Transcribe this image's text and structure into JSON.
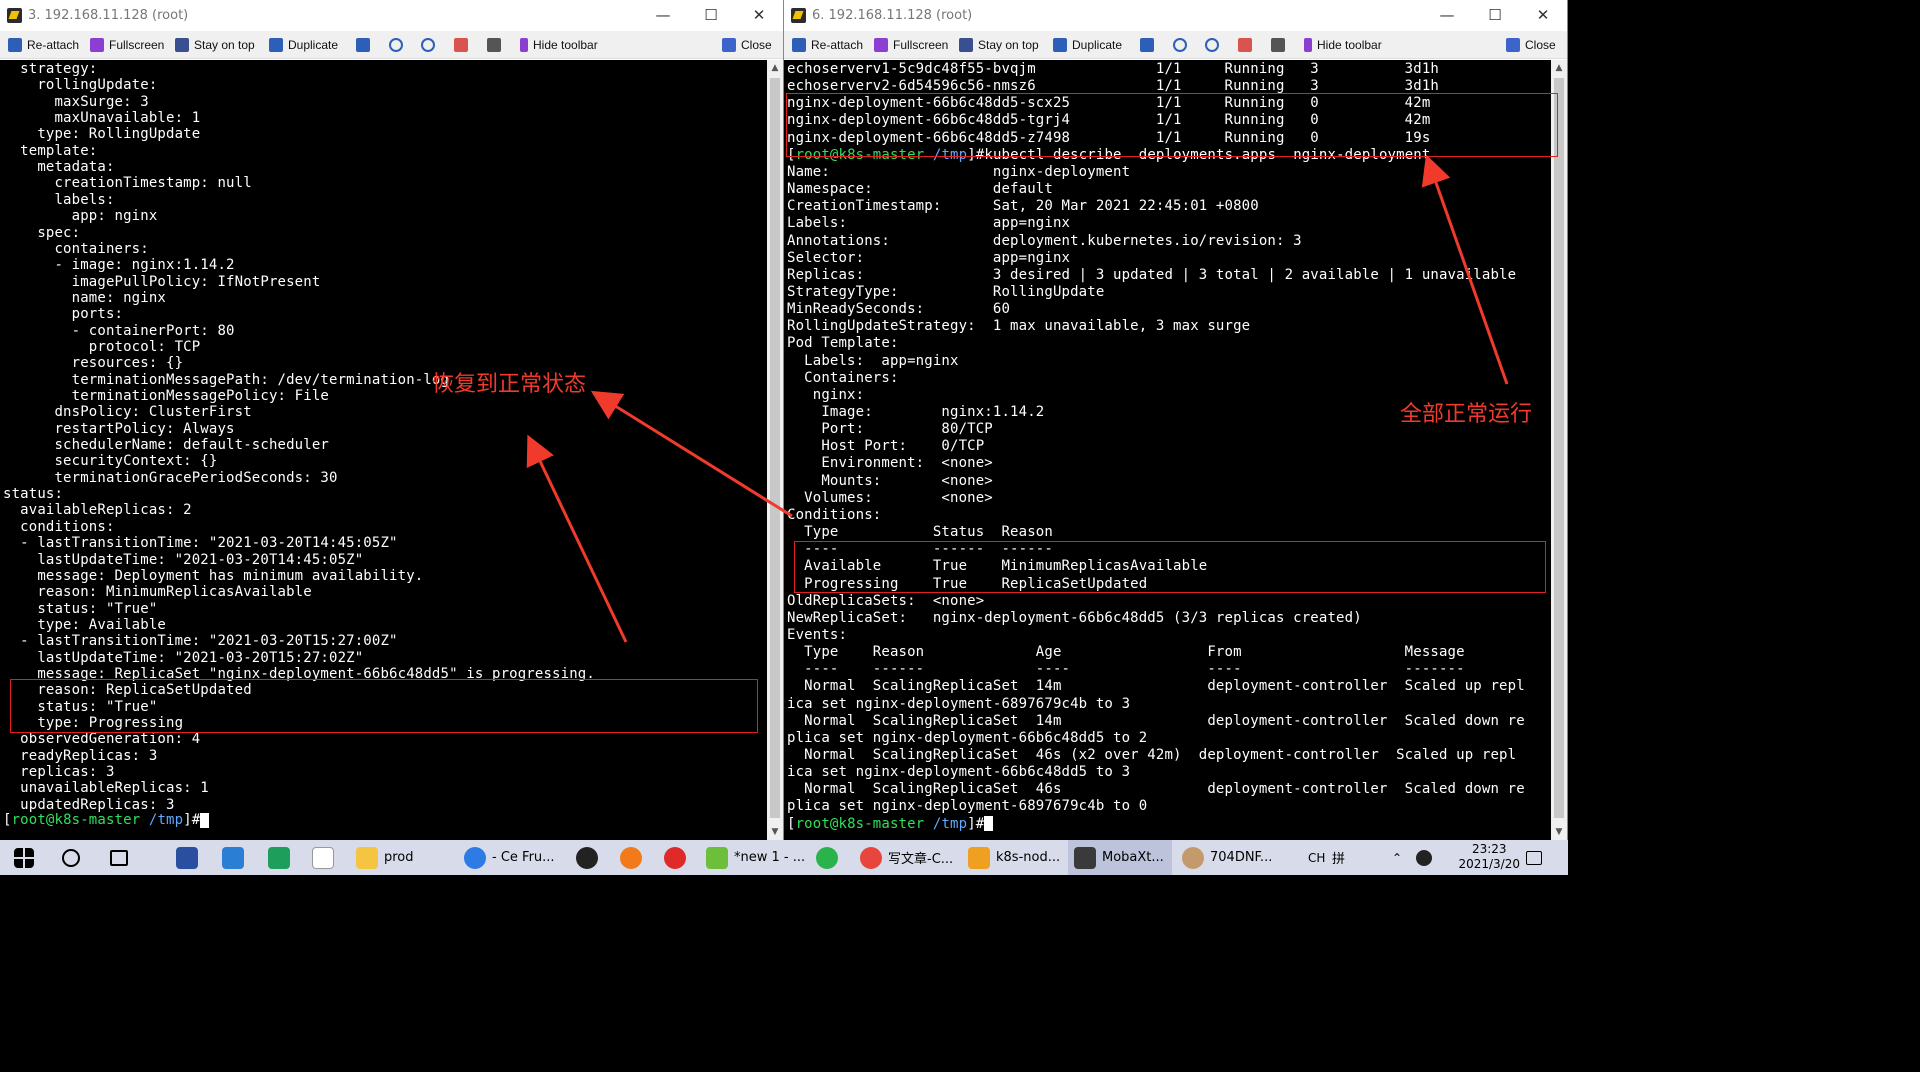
{
  "left_window": {
    "title": "3. 192.168.11.128 (root)",
    "toolbar": {
      "reattach": "Re-attach",
      "fullscreen": "Fullscreen",
      "stay_on_top": "Stay on top",
      "duplicate": "Duplicate",
      "hide_toolbar": "Hide toolbar",
      "close": "Close"
    },
    "lines": [
      "  strategy:",
      "    rollingUpdate:",
      "      maxSurge: 3",
      "      maxUnavailable: 1",
      "    type: RollingUpdate",
      "  template:",
      "    metadata:",
      "      creationTimestamp: null",
      "      labels:",
      "        app: nginx",
      "    spec:",
      "      containers:",
      "      - image: nginx:1.14.2",
      "        imagePullPolicy: IfNotPresent",
      "        name: nginx",
      "        ports:",
      "        - containerPort: 80",
      "          protocol: TCP",
      "        resources: {}",
      "        terminationMessagePath: /dev/termination-log",
      "        terminationMessagePolicy: File",
      "      dnsPolicy: ClusterFirst",
      "      restartPolicy: Always",
      "      schedulerName: default-scheduler",
      "      securityContext: {}",
      "      terminationGracePeriodSeconds: 30",
      "status:",
      "  availableReplicas: 2",
      "  conditions:",
      "  - lastTransitionTime: \"2021-03-20T14:45:05Z\"",
      "    lastUpdateTime: \"2021-03-20T14:45:05Z\"",
      "    message: Deployment has minimum availability.",
      "    reason: MinimumReplicasAvailable",
      "    status: \"True\"",
      "    type: Available",
      "  - lastTransitionTime: \"2021-03-20T15:27:00Z\"",
      "    lastUpdateTime: \"2021-03-20T15:27:02Z\"",
      "    message: ReplicaSet \"nginx-deployment-66b6c48dd5\" is progressing.",
      "    reason: ReplicaSetUpdated",
      "    status: \"True\"",
      "    type: Progressing",
      "  observedGeneration: 4",
      "  readyReplicas: 3",
      "  replicas: 3",
      "  unavailableReplicas: 1",
      "  updatedReplicas: 3"
    ],
    "prompt": {
      "open": "[",
      "user_host": "root@k8s-master",
      "path": " /tmp",
      "close": "]#"
    },
    "annotation": "恢复到正常状态"
  },
  "right_window": {
    "title": "6. 192.168.11.128 (root)",
    "toolbar": {
      "reattach": "Re-attach",
      "fullscreen": "Fullscreen",
      "stay_on_top": "Stay on top",
      "duplicate": "Duplicate",
      "hide_toolbar": "Hide toolbar",
      "close": "Close"
    },
    "lines": [
      "echoserverv1-5c9dc48f55-bvqjm              1/1     Running   3          3d1h",
      "echoserverv2-6d54596c56-nmsz6              1/1     Running   3          3d1h",
      "nginx-deployment-66b6c48dd5-scx25          1/1     Running   0          42m",
      "nginx-deployment-66b6c48dd5-tgrj4          1/1     Running   0          42m",
      "nginx-deployment-66b6c48dd5-z7498          1/1     Running   0          19s",
      "",
      "Name:                   nginx-deployment",
      "Namespace:              default",
      "CreationTimestamp:      Sat, 20 Mar 2021 22:45:01 +0800",
      "Labels:                 app=nginx",
      "Annotations:            deployment.kubernetes.io/revision: 3",
      "Selector:               app=nginx",
      "Replicas:               3 desired | 3 updated | 3 total | 2 available | 1 unavailable",
      "StrategyType:           RollingUpdate",
      "MinReadySeconds:        60",
      "RollingUpdateStrategy:  1 max unavailable, 3 max surge",
      "Pod Template:",
      "  Labels:  app=nginx",
      "  Containers:",
      "   nginx:",
      "    Image:        nginx:1.14.2",
      "    Port:         80/TCP",
      "    Host Port:    0/TCP",
      "    Environment:  <none>",
      "    Mounts:       <none>",
      "  Volumes:        <none>",
      "Conditions:",
      "  Type           Status  Reason",
      "  ----           ------  ------",
      "  Available      True    MinimumReplicasAvailable",
      "  Progressing    True    ReplicaSetUpdated",
      "OldReplicaSets:  <none>",
      "NewReplicaSet:   nginx-deployment-66b6c48dd5 (3/3 replicas created)",
      "Events:",
      "  Type    Reason             Age                 From                   Message",
      "  ----    ------             ----                ----                   -------",
      "  Normal  ScalingReplicaSet  14m                 deployment-controller  Scaled up repl",
      "ica set nginx-deployment-6897679c4b to 3",
      "  Normal  ScalingReplicaSet  14m                 deployment-controller  Scaled down re",
      "plica set nginx-deployment-66b6c48dd5 to 2",
      "  Normal  ScalingReplicaSet  46s (x2 over 42m)  deployment-controller  Scaled up repl",
      "ica set nginx-deployment-66b6c48dd5 to 3",
      "  Normal  ScalingReplicaSet  46s                 deployment-controller  Scaled down re",
      "plica set nginx-deployment-6897679c4b to 0"
    ],
    "command_prompt": {
      "open": "[",
      "user_host": "root@k8s-master",
      "path": " /tmp",
      "close": "]#",
      "command": "kubectl describe  deployments.apps  nginx-deployment"
    },
    "prompt": {
      "open": "[",
      "user_host": "root@k8s-master",
      "path": " /tmp",
      "close": "]#"
    },
    "annotation": "全部正常运行"
  },
  "taskbar": {
    "items": [
      {
        "label": "prod",
        "color": "#f5c542"
      },
      {
        "label": "- Ce Fru...",
        "color": "#2d7be5"
      },
      {
        "label": "*new 1 - ...",
        "color": "#6bbf3b"
      },
      {
        "label": "写文章-C...",
        "color": "#e8453c"
      },
      {
        "label": "k8s-nod...",
        "color": "#f0a020"
      },
      {
        "label": "MobaXt...",
        "color": "#3a3a3a"
      },
      {
        "label": "704DNF...",
        "color": "#c49a6c"
      }
    ],
    "ime": "CH",
    "ime2": "拼",
    "time": "23:23",
    "date": "2021/3/20"
  }
}
